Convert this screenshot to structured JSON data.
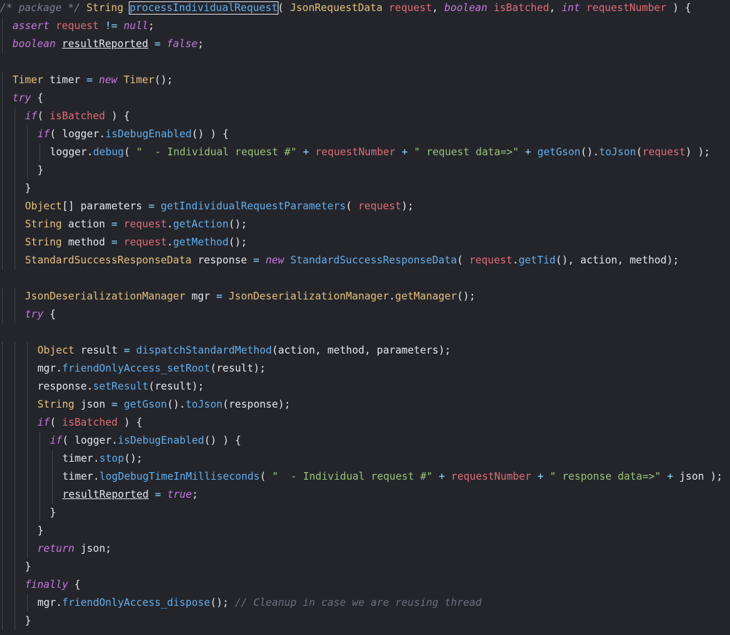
{
  "editor": {
    "language": "java",
    "selected_symbol": "processIndividualRequest",
    "lines": [
      {
        "indent": 0,
        "tokens": [
          [
            "pkgc",
            "/* package */ "
          ],
          [
            "ty",
            "String "
          ],
          [
            "sel",
            "processIndividualRequest"
          ],
          [
            "pn",
            "( "
          ],
          [
            "ty",
            "JsonRequestData "
          ],
          [
            "vr",
            "request"
          ],
          [
            "pn",
            ", "
          ],
          [
            "kw",
            "boolean "
          ],
          [
            "vr",
            "isBatched"
          ],
          [
            "pn",
            ", "
          ],
          [
            "kw",
            "int "
          ],
          [
            "vr",
            "requestNumber"
          ],
          [
            "pn",
            " ) {"
          ]
        ]
      },
      {
        "indent": 1,
        "tokens": [
          [
            "kw",
            "assert "
          ],
          [
            "vr",
            "request "
          ],
          [
            "op",
            "!= "
          ],
          [
            "kw",
            "null"
          ],
          [
            "pn",
            ";"
          ]
        ]
      },
      {
        "indent": 1,
        "tokens": [
          [
            "kw",
            "boolean "
          ],
          [
            "vu",
            "resultReported"
          ],
          [
            "op",
            " = "
          ],
          [
            "kw",
            "false"
          ],
          [
            "pn",
            ";"
          ]
        ]
      },
      {
        "indent": 0,
        "tokens": []
      },
      {
        "indent": 1,
        "tokens": [
          [
            "ty",
            "Timer "
          ],
          [
            "tx",
            "timer "
          ],
          [
            "op",
            "= "
          ],
          [
            "kw",
            "new "
          ],
          [
            "ty",
            "Timer"
          ],
          [
            "pn",
            "();"
          ]
        ]
      },
      {
        "indent": 1,
        "tokens": [
          [
            "kw",
            "try "
          ],
          [
            "pn",
            "{"
          ]
        ]
      },
      {
        "indent": 2,
        "tokens": [
          [
            "kw",
            "if"
          ],
          [
            "pn",
            "( "
          ],
          [
            "vr",
            "isBatched "
          ],
          [
            "pn",
            ") {"
          ]
        ]
      },
      {
        "indent": 3,
        "tokens": [
          [
            "kw",
            "if"
          ],
          [
            "pn",
            "( "
          ],
          [
            "tx",
            "logger"
          ],
          [
            "pn",
            "."
          ],
          [
            "fn",
            "isDebugEnabled"
          ],
          [
            "pn",
            "() ) {"
          ]
        ]
      },
      {
        "indent": 4,
        "tokens": [
          [
            "tx",
            "logger"
          ],
          [
            "pn",
            "."
          ],
          [
            "fn",
            "debug"
          ],
          [
            "pn",
            "( "
          ],
          [
            "st",
            "\"  - Individual request #\""
          ],
          [
            "op",
            " + "
          ],
          [
            "vr",
            "requestNumber"
          ],
          [
            "op",
            " + "
          ],
          [
            "st",
            "\" request data=>\""
          ],
          [
            "op",
            " + "
          ],
          [
            "fn",
            "getGson"
          ],
          [
            "pn",
            "()."
          ],
          [
            "fn",
            "toJson"
          ],
          [
            "pn",
            "("
          ],
          [
            "vr",
            "request"
          ],
          [
            "pn",
            ") );"
          ]
        ]
      },
      {
        "indent": 3,
        "tokens": [
          [
            "pn",
            "}"
          ]
        ]
      },
      {
        "indent": 2,
        "tokens": [
          [
            "pn",
            "}"
          ]
        ]
      },
      {
        "indent": 2,
        "tokens": [
          [
            "ty",
            "Object"
          ],
          [
            "pn",
            "[] "
          ],
          [
            "tx",
            "parameters "
          ],
          [
            "op",
            "= "
          ],
          [
            "fn",
            "getIndividualRequestParameters"
          ],
          [
            "pn",
            "( "
          ],
          [
            "vr",
            "request"
          ],
          [
            "pn",
            ");"
          ]
        ]
      },
      {
        "indent": 2,
        "tokens": [
          [
            "ty",
            "String "
          ],
          [
            "tx",
            "action "
          ],
          [
            "op",
            "= "
          ],
          [
            "vr",
            "request"
          ],
          [
            "pn",
            "."
          ],
          [
            "fn",
            "getAction"
          ],
          [
            "pn",
            "();"
          ]
        ]
      },
      {
        "indent": 2,
        "tokens": [
          [
            "ty",
            "String "
          ],
          [
            "tx",
            "method "
          ],
          [
            "op",
            "= "
          ],
          [
            "vr",
            "request"
          ],
          [
            "pn",
            "."
          ],
          [
            "fn",
            "getMethod"
          ],
          [
            "pn",
            "();"
          ]
        ]
      },
      {
        "indent": 2,
        "tokens": [
          [
            "ty",
            "StandardSuccessResponseData "
          ],
          [
            "tx",
            "response "
          ],
          [
            "op",
            "= "
          ],
          [
            "kw",
            "new "
          ],
          [
            "fn",
            "StandardSuccessResponseData"
          ],
          [
            "pn",
            "( "
          ],
          [
            "vr",
            "request"
          ],
          [
            "pn",
            "."
          ],
          [
            "fn",
            "getTid"
          ],
          [
            "pn",
            "(), "
          ],
          [
            "tx",
            "action"
          ],
          [
            "pn",
            ", "
          ],
          [
            "tx",
            "method"
          ],
          [
            "pn",
            ");"
          ]
        ]
      },
      {
        "indent": 0,
        "tokens": []
      },
      {
        "indent": 2,
        "tokens": [
          [
            "ty",
            "JsonDeserializationManager "
          ],
          [
            "tx",
            "mgr "
          ],
          [
            "op",
            "= "
          ],
          [
            "ty",
            "JsonDeserializationManager"
          ],
          [
            "pn",
            "."
          ],
          [
            "ty",
            "getManager"
          ],
          [
            "pn",
            "();"
          ]
        ]
      },
      {
        "indent": 2,
        "tokens": [
          [
            "kw",
            "try "
          ],
          [
            "pn",
            "{"
          ]
        ]
      },
      {
        "indent": 0,
        "tokens": []
      },
      {
        "indent": 3,
        "tokens": [
          [
            "ty",
            "Object "
          ],
          [
            "tx",
            "result "
          ],
          [
            "op",
            "= "
          ],
          [
            "fn",
            "dispatchStandardMethod"
          ],
          [
            "pn",
            "("
          ],
          [
            "tx",
            "action"
          ],
          [
            "pn",
            ", "
          ],
          [
            "tx",
            "method"
          ],
          [
            "pn",
            ", "
          ],
          [
            "tx",
            "parameters"
          ],
          [
            "pn",
            ");"
          ]
        ]
      },
      {
        "indent": 3,
        "tokens": [
          [
            "tx",
            "mgr"
          ],
          [
            "pn",
            "."
          ],
          [
            "fn",
            "friendOnlyAccess_setRoot"
          ],
          [
            "pn",
            "("
          ],
          [
            "tx",
            "result"
          ],
          [
            "pn",
            ");"
          ]
        ]
      },
      {
        "indent": 3,
        "tokens": [
          [
            "tx",
            "response"
          ],
          [
            "pn",
            "."
          ],
          [
            "fn",
            "setResult"
          ],
          [
            "pn",
            "("
          ],
          [
            "tx",
            "result"
          ],
          [
            "pn",
            ");"
          ]
        ]
      },
      {
        "indent": 3,
        "tokens": [
          [
            "ty",
            "String "
          ],
          [
            "tx",
            "json "
          ],
          [
            "op",
            "= "
          ],
          [
            "fn",
            "getGson"
          ],
          [
            "pn",
            "()."
          ],
          [
            "fn",
            "toJson"
          ],
          [
            "pn",
            "("
          ],
          [
            "tx",
            "response"
          ],
          [
            "pn",
            ");"
          ]
        ]
      },
      {
        "indent": 3,
        "tokens": [
          [
            "kw",
            "if"
          ],
          [
            "pn",
            "( "
          ],
          [
            "vr",
            "isBatched "
          ],
          [
            "pn",
            ") {"
          ]
        ]
      },
      {
        "indent": 4,
        "tokens": [
          [
            "kw",
            "if"
          ],
          [
            "pn",
            "( "
          ],
          [
            "tx",
            "logger"
          ],
          [
            "pn",
            "."
          ],
          [
            "fn",
            "isDebugEnabled"
          ],
          [
            "pn",
            "() ) {"
          ]
        ]
      },
      {
        "indent": 5,
        "tokens": [
          [
            "tx",
            "timer"
          ],
          [
            "pn",
            "."
          ],
          [
            "fn",
            "stop"
          ],
          [
            "pn",
            "();"
          ]
        ]
      },
      {
        "indent": 5,
        "tokens": [
          [
            "tx",
            "timer"
          ],
          [
            "pn",
            "."
          ],
          [
            "fn",
            "logDebugTimeInMilliseconds"
          ],
          [
            "pn",
            "( "
          ],
          [
            "st",
            "\"  - Individual request #\""
          ],
          [
            "op",
            " + "
          ],
          [
            "vr",
            "requestNumber"
          ],
          [
            "op",
            " + "
          ],
          [
            "st",
            "\" response data=>\""
          ],
          [
            "op",
            " + "
          ],
          [
            "tx",
            "json "
          ],
          [
            "pn",
            ");"
          ]
        ]
      },
      {
        "indent": 5,
        "tokens": [
          [
            "vu",
            "resultReported"
          ],
          [
            "op",
            " = "
          ],
          [
            "kw",
            "true"
          ],
          [
            "pn",
            ";"
          ]
        ]
      },
      {
        "indent": 4,
        "tokens": [
          [
            "pn",
            "}"
          ]
        ]
      },
      {
        "indent": 3,
        "tokens": [
          [
            "pn",
            "}"
          ]
        ]
      },
      {
        "indent": 3,
        "tokens": [
          [
            "kw",
            "return "
          ],
          [
            "tx",
            "json"
          ],
          [
            "pn",
            ";"
          ]
        ]
      },
      {
        "indent": 2,
        "tokens": [
          [
            "pn",
            "}"
          ]
        ]
      },
      {
        "indent": 2,
        "tokens": [
          [
            "kw",
            "finally "
          ],
          [
            "pn",
            "{"
          ]
        ]
      },
      {
        "indent": 3,
        "tokens": [
          [
            "tx",
            "mgr"
          ],
          [
            "pn",
            "."
          ],
          [
            "fn",
            "friendOnlyAccess_dispose"
          ],
          [
            "pn",
            "(); "
          ],
          [
            "cm",
            "// Cleanup in case we are reusing thread"
          ]
        ]
      },
      {
        "indent": 2,
        "tokens": [
          [
            "pn",
            "}"
          ]
        ]
      }
    ]
  }
}
